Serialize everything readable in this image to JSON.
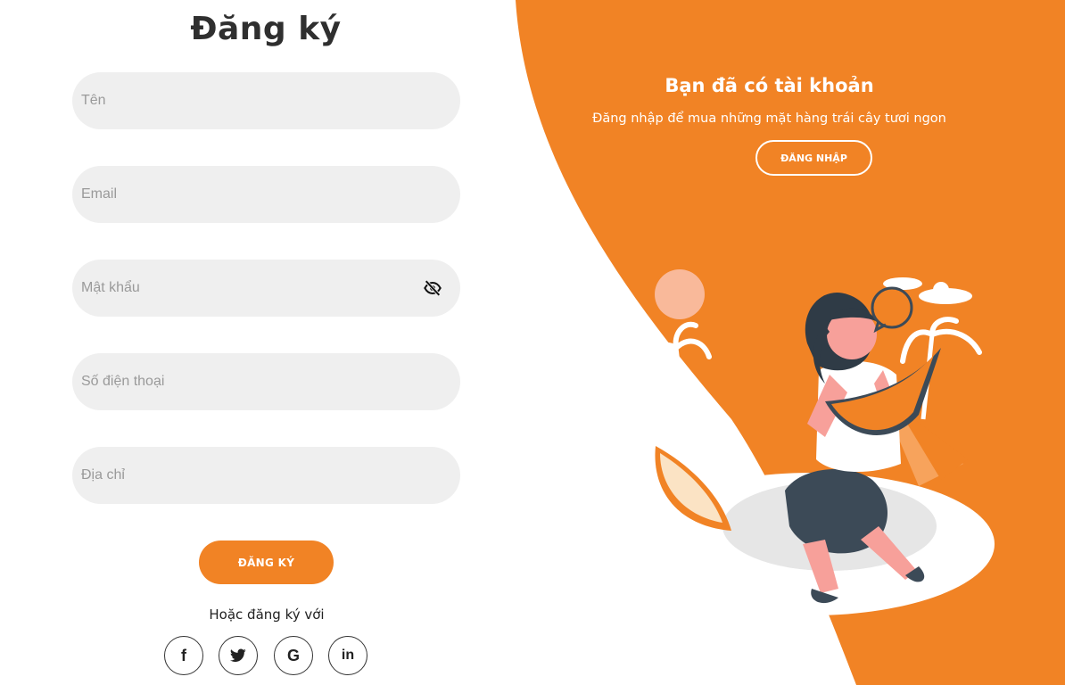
{
  "form": {
    "title": "Đăng ký",
    "fields": [
      {
        "placeholder": "Tên",
        "type": "text"
      },
      {
        "placeholder": "Email",
        "type": "email"
      },
      {
        "placeholder": "Mật khẩu",
        "type": "password"
      },
      {
        "placeholder": "Số điện thoại",
        "type": "tel"
      },
      {
        "placeholder": "Địa chỉ",
        "type": "text"
      }
    ],
    "submit_label": "ĐĂNG KÝ",
    "alt_text": "Hoặc đăng ký với",
    "social": [
      {
        "icon": "facebook-icon",
        "glyph": "f"
      },
      {
        "icon": "twitter-icon",
        "glyph": "t"
      },
      {
        "icon": "google-icon",
        "glyph": "G"
      },
      {
        "icon": "linkedin-icon",
        "glyph": "in"
      }
    ],
    "password_toggle_icon": "eye-slash-icon"
  },
  "info": {
    "title": "Bạn đã có tài khoản",
    "subtitle": "Đăng nhập để mua những mặt hàng trái cây tươi ngon",
    "login_label": "ĐĂNG NHẬP"
  },
  "colors": {
    "accent": "#f18325",
    "field_bg": "#efefef",
    "title_text": "#2f2f2f"
  }
}
